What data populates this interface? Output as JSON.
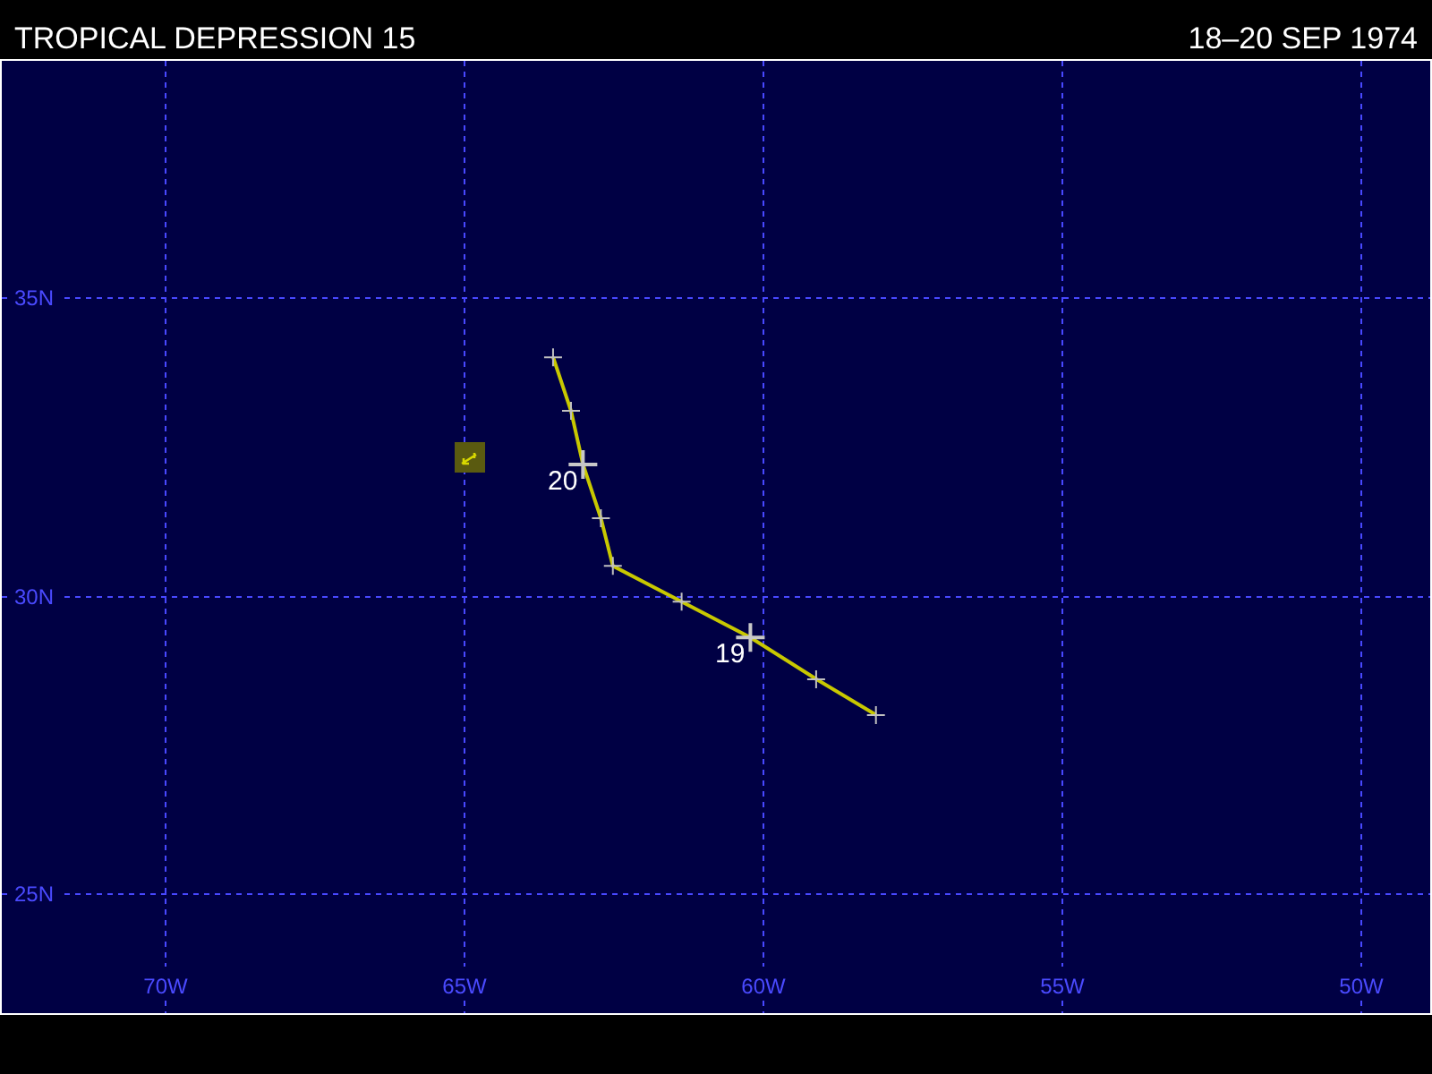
{
  "header": {
    "title": "TROPICAL DEPRESSION 15",
    "dates": "18–20 SEP 1974"
  },
  "map": {
    "chart_data": {
      "type": "line",
      "x": [
        -58.1,
        -59.1,
        -60.2,
        -61.35,
        -62.5,
        -62.7,
        -63.0,
        -63.2,
        -63.5
      ],
      "grid": true,
      "series": [
        {
          "color": "#c8c800",
          "marker": "+",
          "values": [
            28.0,
            28.6,
            29.3,
            29.9,
            30.5,
            31.3,
            32.2,
            33.1,
            34.0
          ]
        }
      ],
      "xlim": [
        -72.72,
        -48.83
      ],
      "ylim": [
        23,
        39
      ],
      "xticks": [
        {
          "value": -70,
          "label": "70W"
        },
        {
          "value": -65,
          "label": "65W"
        },
        {
          "value": -60,
          "label": "60W"
        },
        {
          "value": -55,
          "label": "55W"
        },
        {
          "value": -50,
          "label": "50W"
        }
      ],
      "yticks": [
        {
          "value": 25,
          "label": "25N"
        },
        {
          "value": 30,
          "label": "30N"
        },
        {
          "value": 35,
          "label": "35N"
        }
      ],
      "annotations": [
        {
          "x": -60.2,
          "y": 29.3,
          "text": "19"
        },
        {
          "x": -63.0,
          "y": 32.2,
          "text": "20"
        }
      ]
    }
  }
}
